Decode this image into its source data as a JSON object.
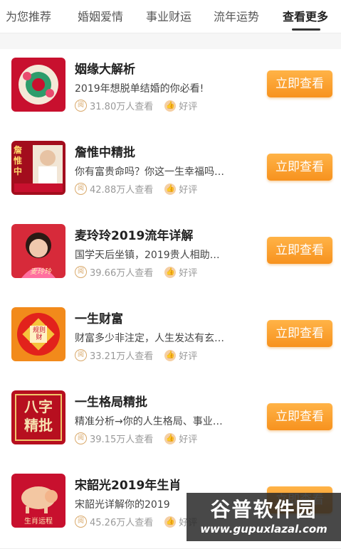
{
  "tabs": [
    {
      "label": "为您推荐"
    },
    {
      "label": "婚姻爱情"
    },
    {
      "label": "事业财运"
    },
    {
      "label": "流年运势"
    },
    {
      "label": "查看更多"
    }
  ],
  "items": [
    {
      "title": "姻缘大解析",
      "desc": "2019年想脱单结婚的你必看!",
      "views": "31.80万人查看",
      "rating": "好评",
      "button": "立即查看",
      "thumb_text": ""
    },
    {
      "title": "詹惟中精批",
      "desc": "你有富贵命吗？你这一生幸福吗…",
      "views": "42.88万人查看",
      "rating": "好评",
      "button": "立即查看",
      "thumb_text": "詹惟中"
    },
    {
      "title": "麦玲玲2019流年详解",
      "desc": "国学天后坐镇，2019贵人相助…",
      "views": "39.66万人查看",
      "rating": "好评",
      "button": "立即查看",
      "thumb_text": "麦玲玲"
    },
    {
      "title": "一生财富",
      "desc": "财富多少非注定，人生发达有玄…",
      "views": "33.21万人查看",
      "rating": "好评",
      "button": "立即查看",
      "thumb_text": "规则财"
    },
    {
      "title": "一生格局精批",
      "desc": "精准分析→你的人生格局、事业…",
      "views": "39.15万人查看",
      "rating": "好评",
      "button": "立即查看",
      "thumb_text": "八字精批"
    },
    {
      "title": "宋韶光2019年生肖",
      "desc": "宋韶光详解你的2019",
      "views": "45.26万人查看",
      "rating": "好评",
      "button": "立即查看",
      "thumb_text": "生肖运程"
    }
  ],
  "watermark": {
    "top": "谷普软件园",
    "bottom": "www.gupuxlazal.com"
  },
  "colors": {
    "accent": "#f7921e",
    "thumb_red": "#c8102e"
  }
}
